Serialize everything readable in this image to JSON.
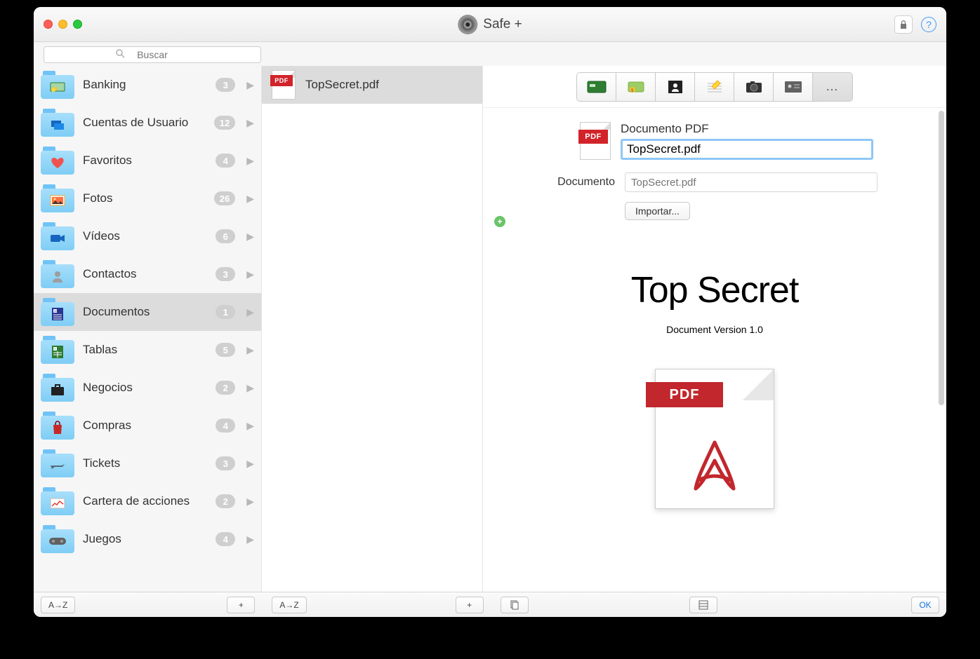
{
  "app": {
    "title": "Safe +"
  },
  "search": {
    "placeholder": "Buscar"
  },
  "sidebar": {
    "items": [
      {
        "label": "Banking",
        "count": "3",
        "icon": "bank"
      },
      {
        "label": "Cuentas de Usuario",
        "count": "12",
        "icon": "user-accounts"
      },
      {
        "label": "Favoritos",
        "count": "4",
        "icon": "heart"
      },
      {
        "label": "Fotos",
        "count": "26",
        "icon": "photos"
      },
      {
        "label": "Vídeos",
        "count": "6",
        "icon": "video"
      },
      {
        "label": "Contactos",
        "count": "3",
        "icon": "contact"
      },
      {
        "label": "Documentos",
        "count": "1",
        "icon": "doc",
        "selected": true
      },
      {
        "label": "Tablas",
        "count": "5",
        "icon": "sheet"
      },
      {
        "label": "Negocios",
        "count": "2",
        "icon": "briefcase"
      },
      {
        "label": "Compras",
        "count": "4",
        "icon": "shopping"
      },
      {
        "label": "Tickets",
        "count": "3",
        "icon": "plane"
      },
      {
        "label": "Cartera de acciones",
        "count": "2",
        "icon": "stocks"
      },
      {
        "label": "Juegos",
        "count": "4",
        "icon": "gamepad"
      }
    ]
  },
  "files": {
    "items": [
      {
        "label": "TopSecret.pdf",
        "selected": true
      }
    ]
  },
  "detail": {
    "type_label": "Documento PDF",
    "name_value": "TopSecret.pdf",
    "doc_label": "Documento",
    "doc_placeholder": "TopSecret.pdf",
    "import_label": "Importar...",
    "preview_title": "Top Secret",
    "preview_sub": "Document Version 1.0",
    "pdf_badge": "PDF"
  },
  "footer": {
    "sort": "A→Z",
    "add": "+",
    "ok": "OK"
  }
}
